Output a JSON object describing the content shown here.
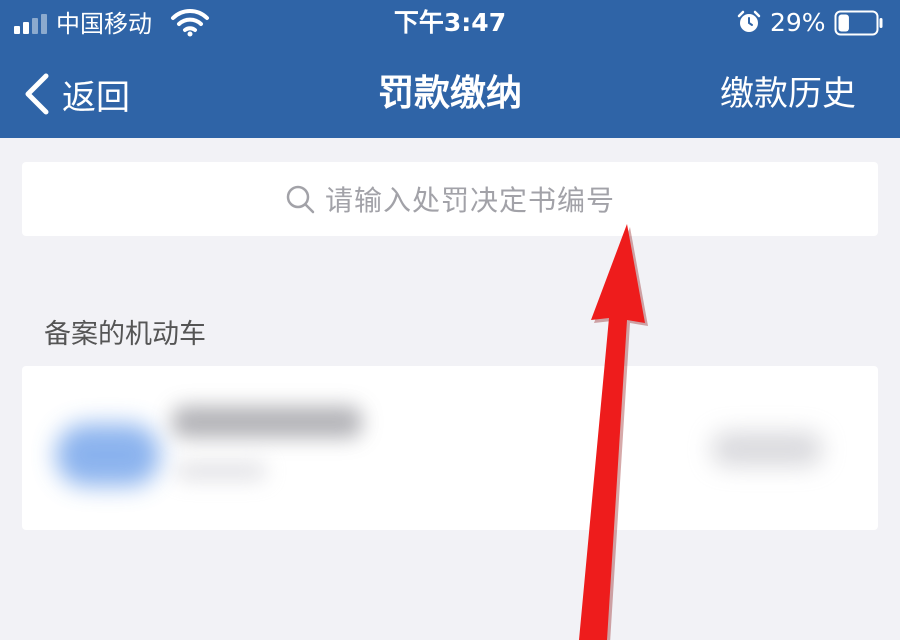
{
  "status_bar": {
    "carrier": "中国移动",
    "time": "下午3:47",
    "battery_percent": "29%",
    "signal_bars": 2,
    "signal_icon": "signal-icon",
    "wifi_icon": "wifi-icon",
    "alarm_icon": "alarm-icon",
    "battery_icon": "battery-icon",
    "battery_level": 0.29
  },
  "nav": {
    "back_label": "返回",
    "back_icon": "chevron-left-icon",
    "title": "罚款缴纳",
    "history_label": "缴款历史"
  },
  "search": {
    "icon": "search-icon",
    "placeholder": "请输入处罚决定书编号"
  },
  "vehicles": {
    "section_label": "备案的机动车"
  },
  "annotation": {
    "arrow_color": "#ee1c1c",
    "arrow_icon": "red-arrow-icon"
  },
  "colors": {
    "nav_background": "#2f64a7",
    "page_background": "#f2f2f6",
    "placeholder_text": "#a2a2a8"
  }
}
